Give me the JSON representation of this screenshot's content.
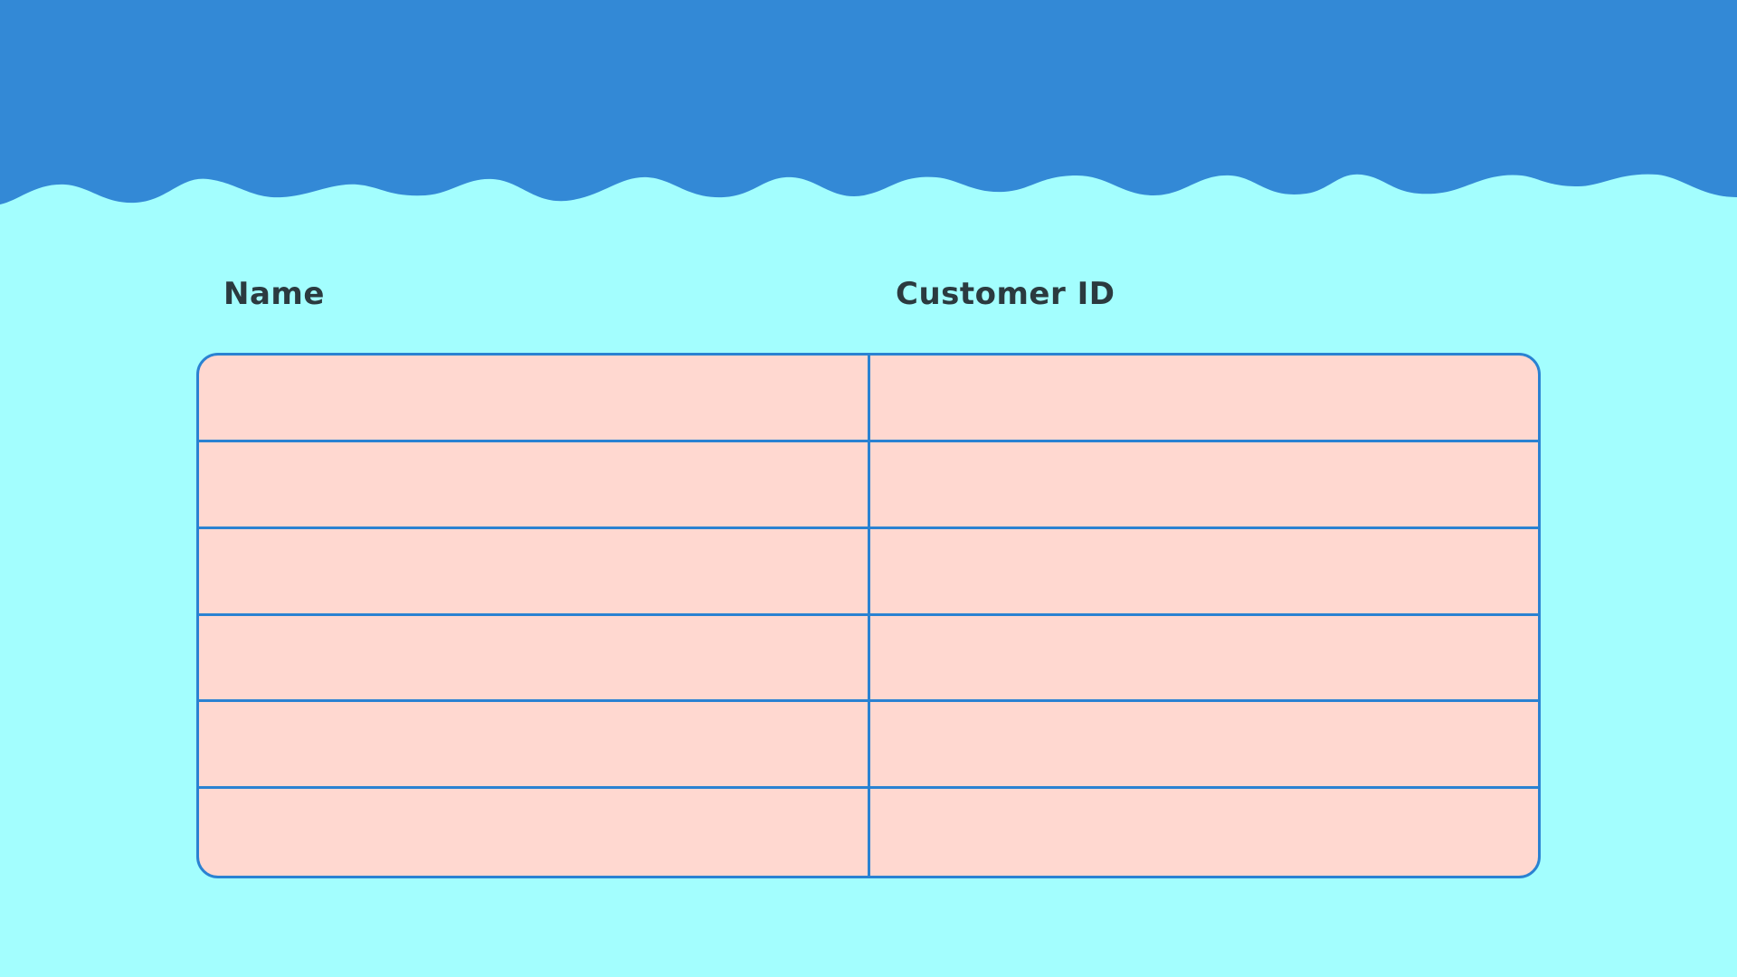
{
  "colors": {
    "background": "#a3fefe",
    "header_band": "#3389d6",
    "table_fill": "#ffd8d0",
    "table_border": "#2a82d2",
    "header_text": "#2b3a3f"
  },
  "table": {
    "columns": [
      "Name",
      "Customer ID"
    ],
    "rows": [
      [
        "",
        ""
      ],
      [
        "",
        ""
      ],
      [
        "",
        ""
      ],
      [
        "",
        ""
      ],
      [
        "",
        ""
      ],
      [
        "",
        ""
      ]
    ]
  }
}
